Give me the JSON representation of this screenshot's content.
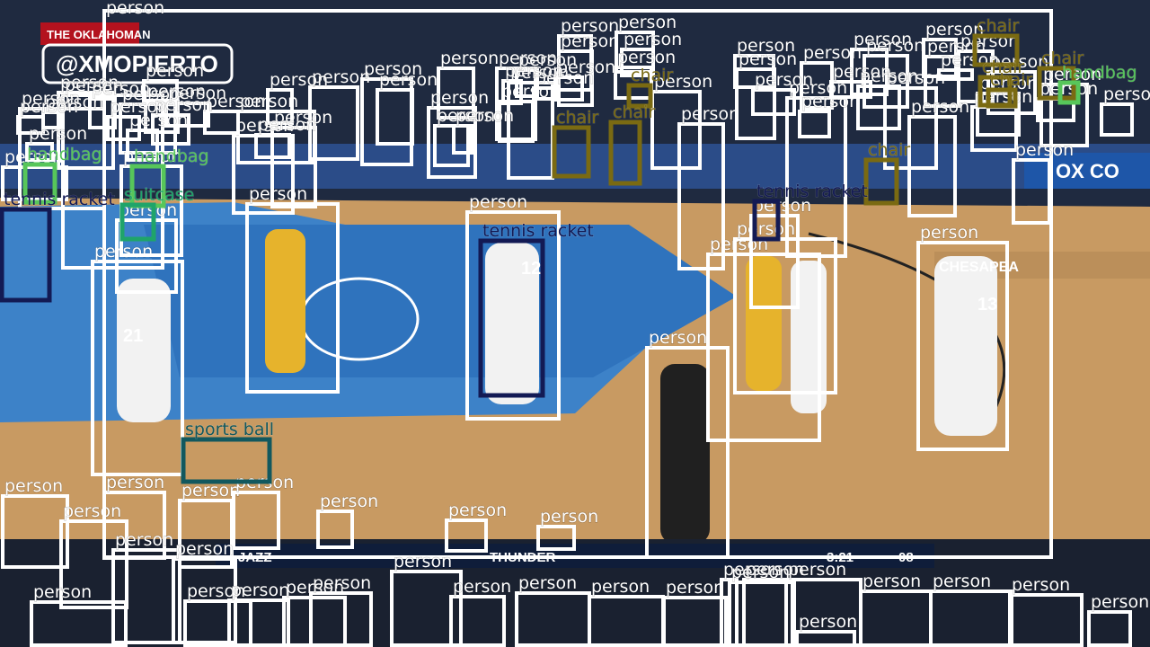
{
  "scene": {
    "signage": {
      "banner_top": "THE OKLAHOMAN",
      "watermark": "@XMOPIERTO",
      "sponsor_right": "OX CO",
      "court_right": "CHESAPEA",
      "scoreboard_left": "JAZZ",
      "scoreboard_right": "THUNDER",
      "scoreboard_clock": "3:21",
      "scoreboard_shot": "08"
    },
    "jerseys": [
      "21",
      "12",
      "13"
    ]
  },
  "colors": {
    "person": "#ffffff",
    "chair": "#7a6a12",
    "handbag": "#57c65a",
    "suitcase": "#1fa46a",
    "tennis racket": "#131a54",
    "sports ball": "#12585e"
  },
  "detections": [
    {
      "label": "person"
    },
    {
      "label": "person"
    },
    {
      "label": "person"
    },
    {
      "label": "person"
    },
    {
      "label": "person"
    },
    {
      "label": "person"
    },
    {
      "label": "person"
    },
    {
      "label": "person"
    },
    {
      "label": "person"
    },
    {
      "label": "person"
    },
    {
      "label": "person"
    },
    {
      "label": "person"
    },
    {
      "label": "person"
    },
    {
      "label": "person"
    },
    {
      "label": "person"
    },
    {
      "label": "person"
    },
    {
      "label": "person"
    },
    {
      "label": "person"
    },
    {
      "label": "person"
    },
    {
      "label": "person"
    },
    {
      "label": "person"
    },
    {
      "label": "person"
    },
    {
      "label": "person"
    },
    {
      "label": "person"
    },
    {
      "label": "person"
    },
    {
      "label": "person"
    },
    {
      "label": "person"
    },
    {
      "label": "person"
    },
    {
      "label": "person"
    },
    {
      "label": "person"
    },
    {
      "label": "person"
    },
    {
      "label": "person"
    },
    {
      "label": "person"
    },
    {
      "label": "person"
    },
    {
      "label": "person"
    },
    {
      "label": "person"
    },
    {
      "label": "person"
    },
    {
      "label": "person"
    },
    {
      "label": "person"
    },
    {
      "label": "person"
    },
    {
      "label": "person"
    },
    {
      "label": "person"
    },
    {
      "label": "person"
    },
    {
      "label": "person"
    },
    {
      "label": "person"
    },
    {
      "label": "person"
    },
    {
      "label": "person"
    },
    {
      "label": "person"
    },
    {
      "label": "person"
    },
    {
      "label": "person"
    },
    {
      "label": "person"
    },
    {
      "label": "person"
    },
    {
      "label": "person"
    },
    {
      "label": "person"
    },
    {
      "label": "person"
    },
    {
      "label": "person"
    },
    {
      "label": "person"
    },
    {
      "label": "person"
    },
    {
      "label": "person"
    },
    {
      "label": "person"
    },
    {
      "label": "person"
    },
    {
      "label": "person"
    },
    {
      "label": "person"
    },
    {
      "label": "person"
    },
    {
      "label": "person"
    },
    {
      "label": "person"
    },
    {
      "label": "person"
    },
    {
      "label": "person"
    },
    {
      "label": "person"
    },
    {
      "label": "person"
    },
    {
      "label": "person"
    },
    {
      "label": "person"
    },
    {
      "label": "person"
    },
    {
      "label": "person"
    },
    {
      "label": "person"
    },
    {
      "label": "person"
    },
    {
      "label": "person"
    },
    {
      "label": "person"
    },
    {
      "label": "person"
    },
    {
      "label": "person"
    },
    {
      "label": "person"
    },
    {
      "label": "person"
    },
    {
      "label": "person"
    },
    {
      "label": "person"
    },
    {
      "label": "person"
    },
    {
      "label": "person"
    },
    {
      "label": "person"
    },
    {
      "label": "person"
    },
    {
      "label": "person"
    },
    {
      "label": "person"
    },
    {
      "label": "person"
    },
    {
      "label": "person"
    },
    {
      "label": "person"
    },
    {
      "label": "person"
    },
    {
      "label": "person"
    },
    {
      "label": "person"
    },
    {
      "label": "person"
    },
    {
      "label": "person"
    },
    {
      "label": "person"
    },
    {
      "label": "person"
    },
    {
      "label": "person"
    },
    {
      "label": "person"
    },
    {
      "label": "person"
    },
    {
      "label": "person"
    },
    {
      "label": "person"
    },
    {
      "label": "chair"
    },
    {
      "label": "chair"
    },
    {
      "label": "chair"
    },
    {
      "label": "chair"
    },
    {
      "label": "chair"
    },
    {
      "label": "chair"
    },
    {
      "label": "chair"
    },
    {
      "label": "chair"
    },
    {
      "label": "handbag"
    },
    {
      "label": "handbag"
    },
    {
      "label": "handbag"
    },
    {
      "label": "suitcase"
    },
    {
      "label": "tennis racket"
    },
    {
      "label": "tennis racket"
    },
    {
      "label": "tennis racket"
    },
    {
      "label": "sports ball"
    }
  ]
}
